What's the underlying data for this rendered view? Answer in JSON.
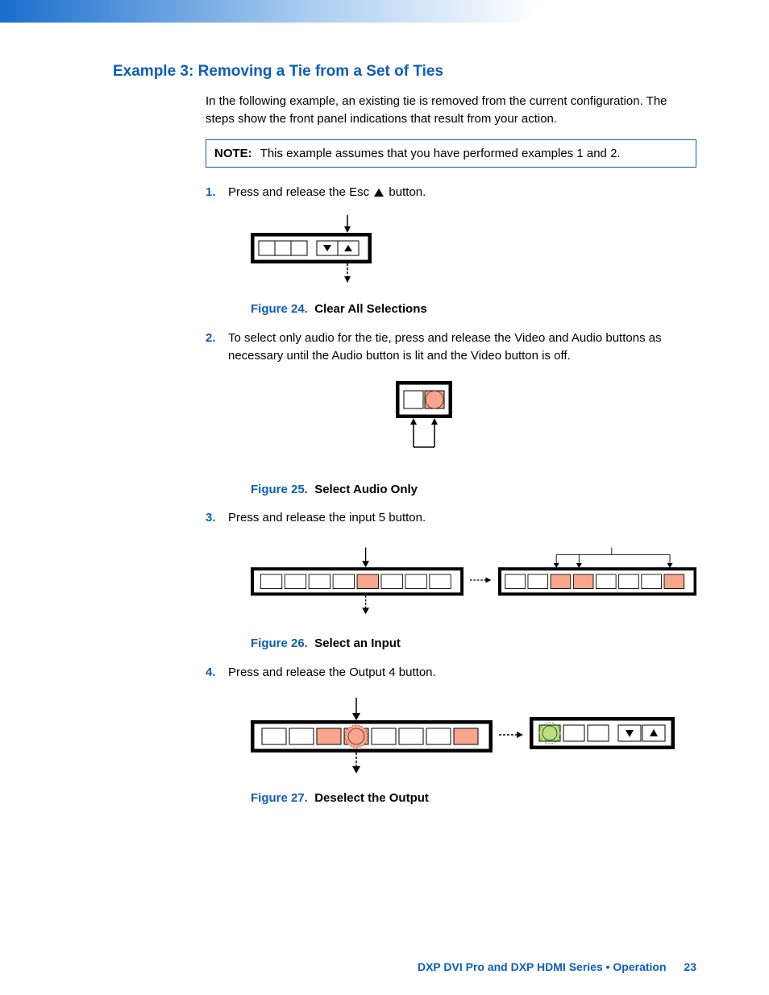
{
  "heading": "Example 3: Removing a Tie from a Set of Ties",
  "intro": "In the following example, an existing tie is removed from the current configuration. The steps show the front panel indications that result from your action.",
  "note": {
    "label": "NOTE:",
    "text": "This example assumes that you have performed examples 1 and 2."
  },
  "steps": [
    {
      "pre": "Press and release the Esc ",
      "post": " button."
    },
    {
      "text": "To select only audio for the tie, press and release the Video and Audio buttons as necessary until the Audio button is lit and the Video button is off."
    },
    {
      "text": "Press and release the input 5 button."
    },
    {
      "text": "Press and release the Output 4 button."
    }
  ],
  "figures": [
    {
      "num": "Figure 24.",
      "title": "Clear All Selections"
    },
    {
      "num": "Figure 25.",
      "title": "Select Audio Only"
    },
    {
      "num": "Figure 26.",
      "title": "Select an Input"
    },
    {
      "num": "Figure 27.",
      "title": "Deselect the Output"
    }
  ],
  "footer": {
    "text": "DXP DVI Pro and DXP HDMI Series • Operation",
    "page": "23"
  },
  "colors": {
    "accent": "#0b5dbd",
    "lit_amber": "#f7a58b",
    "lit_green": "#b9e07f"
  }
}
